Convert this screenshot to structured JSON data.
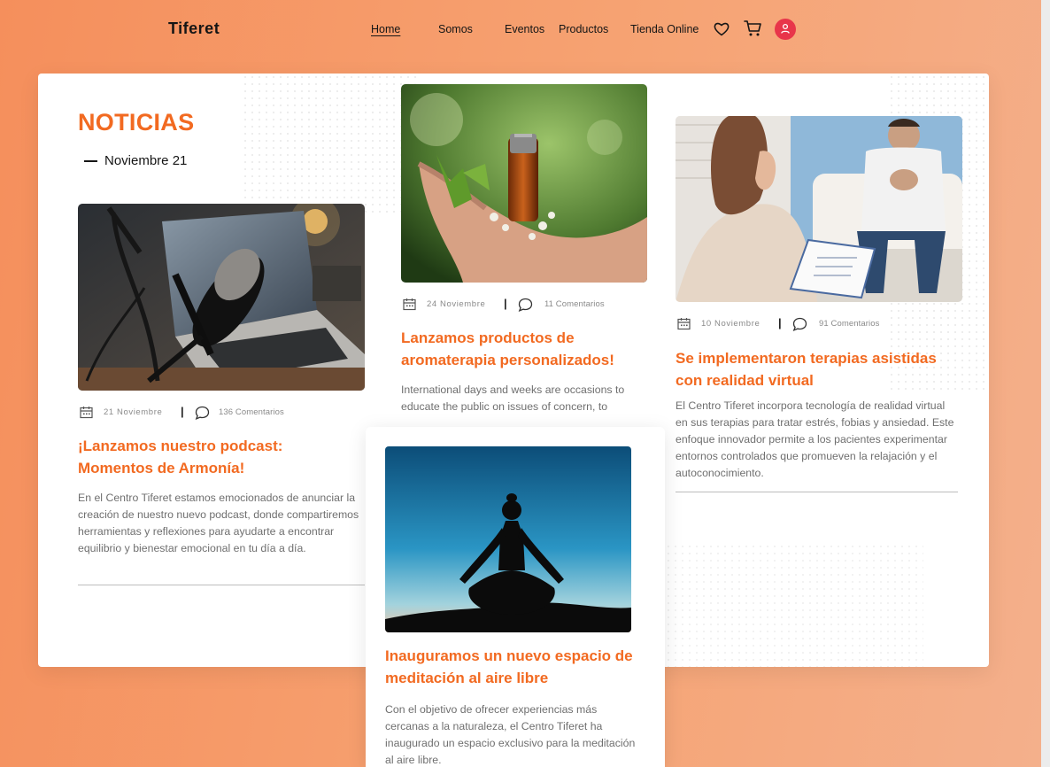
{
  "header": {
    "logo": "Tiferet",
    "nav": [
      "Home",
      "Somos",
      "Eventos",
      "Productos",
      "Tienda Online"
    ],
    "icons": [
      "heart-icon",
      "cart-icon",
      "user-icon"
    ]
  },
  "colors": {
    "accent": "#f26a21",
    "user_button": "#e8354a",
    "text": "#151515",
    "muted": "#6f6f6f"
  },
  "news": {
    "title": "NOTICIAS",
    "subtitle": "Noviembre 21",
    "articles": [
      {
        "date": "21 Noviembre",
        "comments": "136 Comentarios",
        "title": "¡Lanzamos nuestro podcast: Momentos de Armonía!",
        "body": "En el Centro Tiferet estamos emocionados de anunciar la creación de nuestro nuevo podcast, donde compartiremos herramientas y reflexiones para ayudarte a encontrar equilibrio y bienestar emocional en tu día a día."
      },
      {
        "date": "24 Noviembre",
        "comments": "11 Comentarios",
        "title": "Lanzamos productos de aromaterapia personalizados!",
        "body": "International days and weeks are occasions to educate the public on issues of concern, to"
      },
      {
        "date": "10 Noviembre",
        "comments": "91 Comentarios",
        "title": "Se implementaron terapias asistidas con realidad virtual",
        "body": "El Centro Tiferet incorpora tecnología de realidad virtual en sus terapias para tratar estrés, fobias y ansiedad. Este enfoque innovador permite a los pacientes experimentar entornos controlados que promueven la relajación y el autoconocimiento."
      },
      {
        "title": "Inauguramos un nuevo espacio de meditación al aire libre",
        "body": "Con el objetivo de ofrecer experiencias más cercanas a la naturaleza, el Centro Tiferet ha inaugurado un espacio exclusivo para la meditación al aire libre."
      }
    ]
  }
}
